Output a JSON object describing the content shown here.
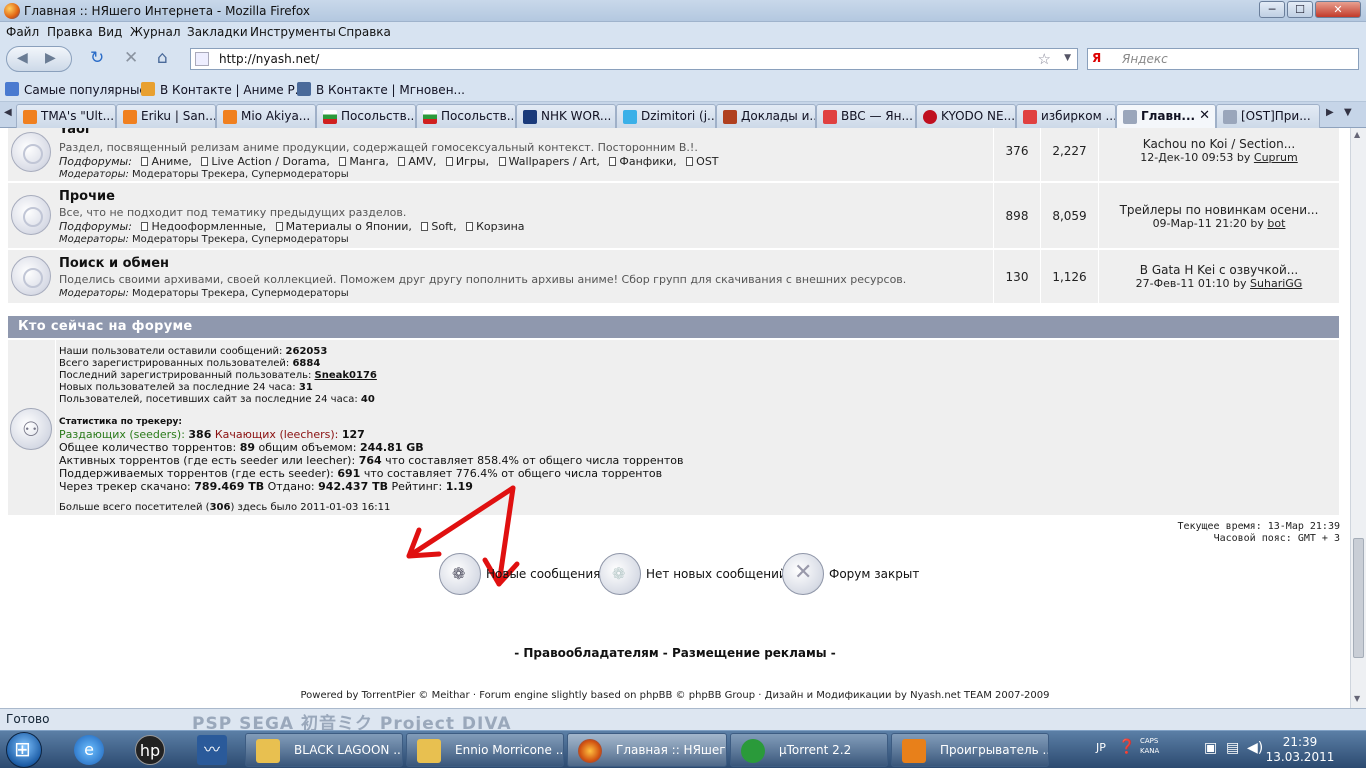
{
  "window": {
    "title": "Главная :: НЯшего Интернета - Mozilla Firefox",
    "min": "─",
    "max": "☐",
    "close": "✕"
  },
  "menu": [
    "Файл",
    "Правка",
    "Вид",
    "Журнал",
    "Закладки",
    "Инструменты",
    "Справка"
  ],
  "nav": {
    "back_icon": "◀",
    "forward_icon": "▶",
    "reload_icon": "↻",
    "stop_icon": "✕",
    "home_icon": "⌂",
    "url": "http://nyash.net/",
    "star_icon": "☆",
    "search_engine": "Я",
    "search_placeholder": "Яндекс"
  },
  "bookmarks": [
    "Самые популярные",
    "В Контакте | Аниме Р...",
    "В Контакте | Мгновен..."
  ],
  "tabs": [
    "TMA's \"Ult...",
    "Eriku | San...",
    "Mio Akiya...",
    "Посольств...",
    "Посольств...",
    "NHK WOR...",
    "Dzimitori (j...",
    "Доклады и...",
    "BBC — Ян...",
    "KYODO NE...",
    "избирком ...",
    "Главн...",
    "[OST]При..."
  ],
  "forums": [
    {
      "name": "Yaoi",
      "desc": "Раздел, посвященный релизам аниме продукции, содержащей гомосексуальный контекст. Посторонним В.!.",
      "sub_label": "Подфорумы:",
      "subforums": [
        "Аниме",
        "Live Action / Dorama",
        "Манга",
        "AMV",
        "Игры",
        "Wallpapers / Art",
        "Фанфики",
        "OST"
      ],
      "mod_label": "Модераторы:",
      "mods": "Модераторы Трекера, Супермодераторы",
      "topics": "376",
      "posts": "2,227",
      "last_title": "Kachou no Koi / Section...",
      "last_date": "12-Дек-10 09:53",
      "last_by": "by",
      "last_user": "Cuprum"
    },
    {
      "name": "Прочие",
      "desc": "Все, что не подходит под тематику предыдущих разделов.",
      "sub_label": "Подфорумы:",
      "subforums": [
        "Недооформленные",
        "Материалы о Японии",
        "Soft",
        "Корзина"
      ],
      "mod_label": "Модераторы:",
      "mods": "Модераторы Трекера, Супермодераторы",
      "topics": "898",
      "posts": "8,059",
      "last_title": "Трейлеры по новинкам осени...",
      "last_date": "09-Мар-11 21:20",
      "last_by": "by",
      "last_user": "bot"
    },
    {
      "name": "Поиск и обмен",
      "desc": "Поделись своими архивами, своей коллекцией. Поможем друг другу пополнить архивы аниме! Сбор групп для скачивания с внешних ресурсов.",
      "mod_label": "Модераторы:",
      "mods": "Модераторы Трекера, Супермодераторы",
      "topics": "130",
      "posts": "1,126",
      "last_title": "В Gata H Kei с озвучкой...",
      "last_date": "27-Фев-11 01:10",
      "last_by": "by",
      "last_user": "SuhariGG"
    }
  ],
  "online": {
    "header": "Кто сейчас на форуме",
    "l1_label": "Наши пользователи оставили сообщений:",
    "l1_val": "262053",
    "l2_label": "Всего зарегистрированных пользователей:",
    "l2_val": "6884",
    "l3_label": "Последний зарегистрированный пользователь:",
    "l3_val": "Sneak0176",
    "l4_label": "Новых пользователей за последние 24 часа:",
    "l4_val": "31",
    "l5_label": "Пользователей, посетивших сайт за последние 24 часа:",
    "l5_val": "40",
    "tracker_title": "Статистика по трекеру:",
    "seeders_label": "Раздающих (seeders):",
    "seeders": "386",
    "leechers_label": "Качающих (leechers):",
    "leechers": "127",
    "total_label": "Общее количество торрентов:",
    "total": "89",
    "volume_label": "общим объемом:",
    "volume": "244.81 GB",
    "active_label": "Активных торрентов (где есть seeder или leecher):",
    "active": "764",
    "active_tail": "что составляет 858.4% от общего числа торрентов",
    "supported_label": "Поддерживаемых торрентов (где есть seeder):",
    "supported": "691",
    "supported_tail": "что составляет 776.4% от общего числа торрентов",
    "down_label": "Через трекер скачано:",
    "down": "789.469 TB",
    "up_label": "Отдано:",
    "up": "942.437 TB",
    "ratio_label": "Рейтинг:",
    "ratio": "1.19",
    "max_pre": "Больше всего посетителей (",
    "max_val": "306",
    "max_post": ") здесь было 2011-01-03 16:11"
  },
  "time": {
    "current": "Текущее время: 13-Мар 21:39",
    "tz": "Часовой пояс: GMT + 3"
  },
  "legend": [
    "Новые сообщения",
    "Нет новых сообщений",
    "Форум закрыт"
  ],
  "footer": {
    "links": "- Правообладателям - Размещение рекламы -",
    "powered": "Powered by TorrentPier © Meithar · Forum engine slightly based on phpBB © phpBB Group · Дизайн и Модификации by Nyash.net TEAM 2007-2009"
  },
  "status": {
    "text": "Готово",
    "logos": "PSP   SEGA   初音ミク Project DIVA"
  },
  "taskbar": {
    "tasks": [
      "BLACK LAGOON ...",
      "Ennio Morricone ...",
      "Главная :: НЯшег...",
      "µTorrent 2.2",
      "Проигрыватель ..."
    ],
    "lang": "JP",
    "caps": "CAPS",
    "kana": "KANA",
    "time": "21:39",
    "date": "13.03.2011"
  },
  "colors": {
    "header_bg": "#8f98ae",
    "row_bg": "#efefef",
    "seeders": "#2a7a1a",
    "leechers": "#8a1010",
    "arrow": "#e01010"
  }
}
